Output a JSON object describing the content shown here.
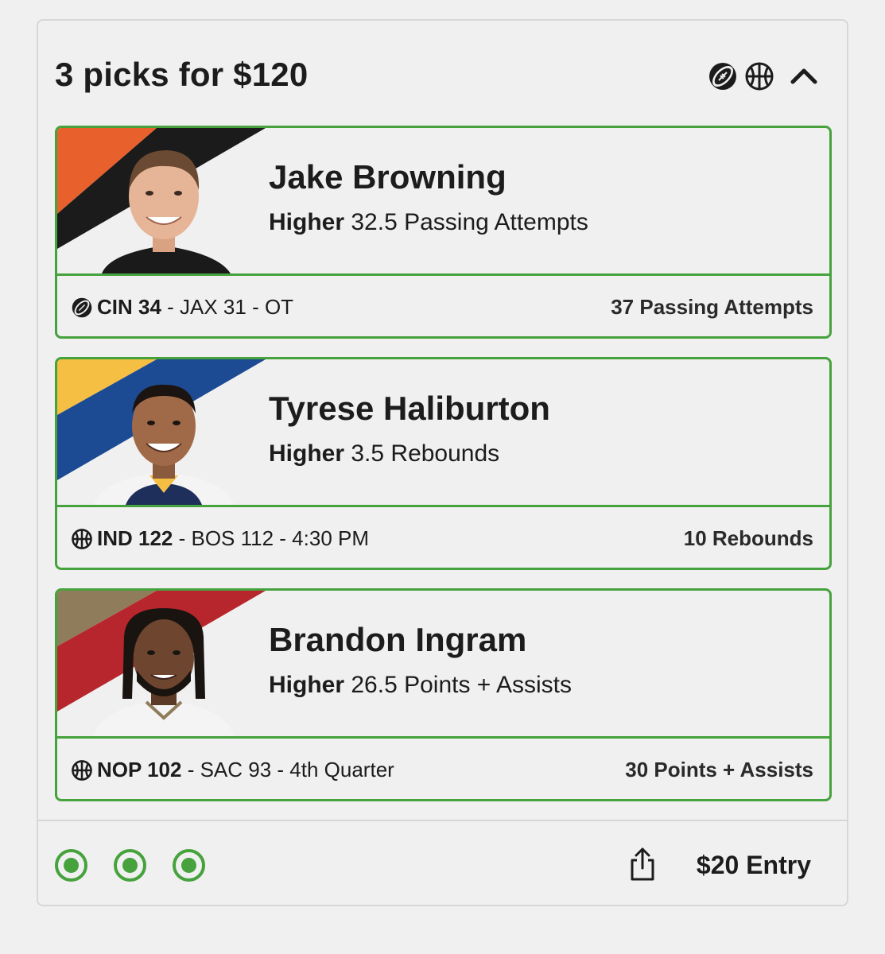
{
  "title": "3 picks for $120",
  "header_icons": [
    "football-icon",
    "basketball-icon",
    "chevron-up-icon"
  ],
  "colors": {
    "accent": "#46a23c",
    "border": "#d7d7d7",
    "background": "#f0f0f0"
  },
  "picks": [
    {
      "name": "Jake Browning",
      "direction": "Higher",
      "line": "32.5 Passing Attempts",
      "sport_icon": "football-icon",
      "team": "CIN 34",
      "rest": " - JAX 31 - OT",
      "result": "37 Passing Attempts",
      "team_colors": [
        "#e8612c",
        "#1b1b1b"
      ]
    },
    {
      "name": "Tyrese Haliburton",
      "direction": "Higher",
      "line": "3.5 Rebounds",
      "sport_icon": "basketball-icon",
      "team": "IND 122",
      "rest": " - BOS 112 - 4:30 PM",
      "result": "10 Rebounds",
      "team_colors": [
        "#f5bf43",
        "#1d4b93"
      ]
    },
    {
      "name": "Brandon Ingram",
      "direction": "Higher",
      "line": "26.5 Points + Assists",
      "sport_icon": "basketball-icon",
      "team": "NOP 102",
      "rest": " - SAC 93 - 4th Quarter",
      "result": "30 Points + Assists",
      "team_colors": [
        "#8f7c5a",
        "#b8262d"
      ]
    }
  ],
  "footer": {
    "status_dots": 3,
    "entry": "$20 Entry"
  }
}
